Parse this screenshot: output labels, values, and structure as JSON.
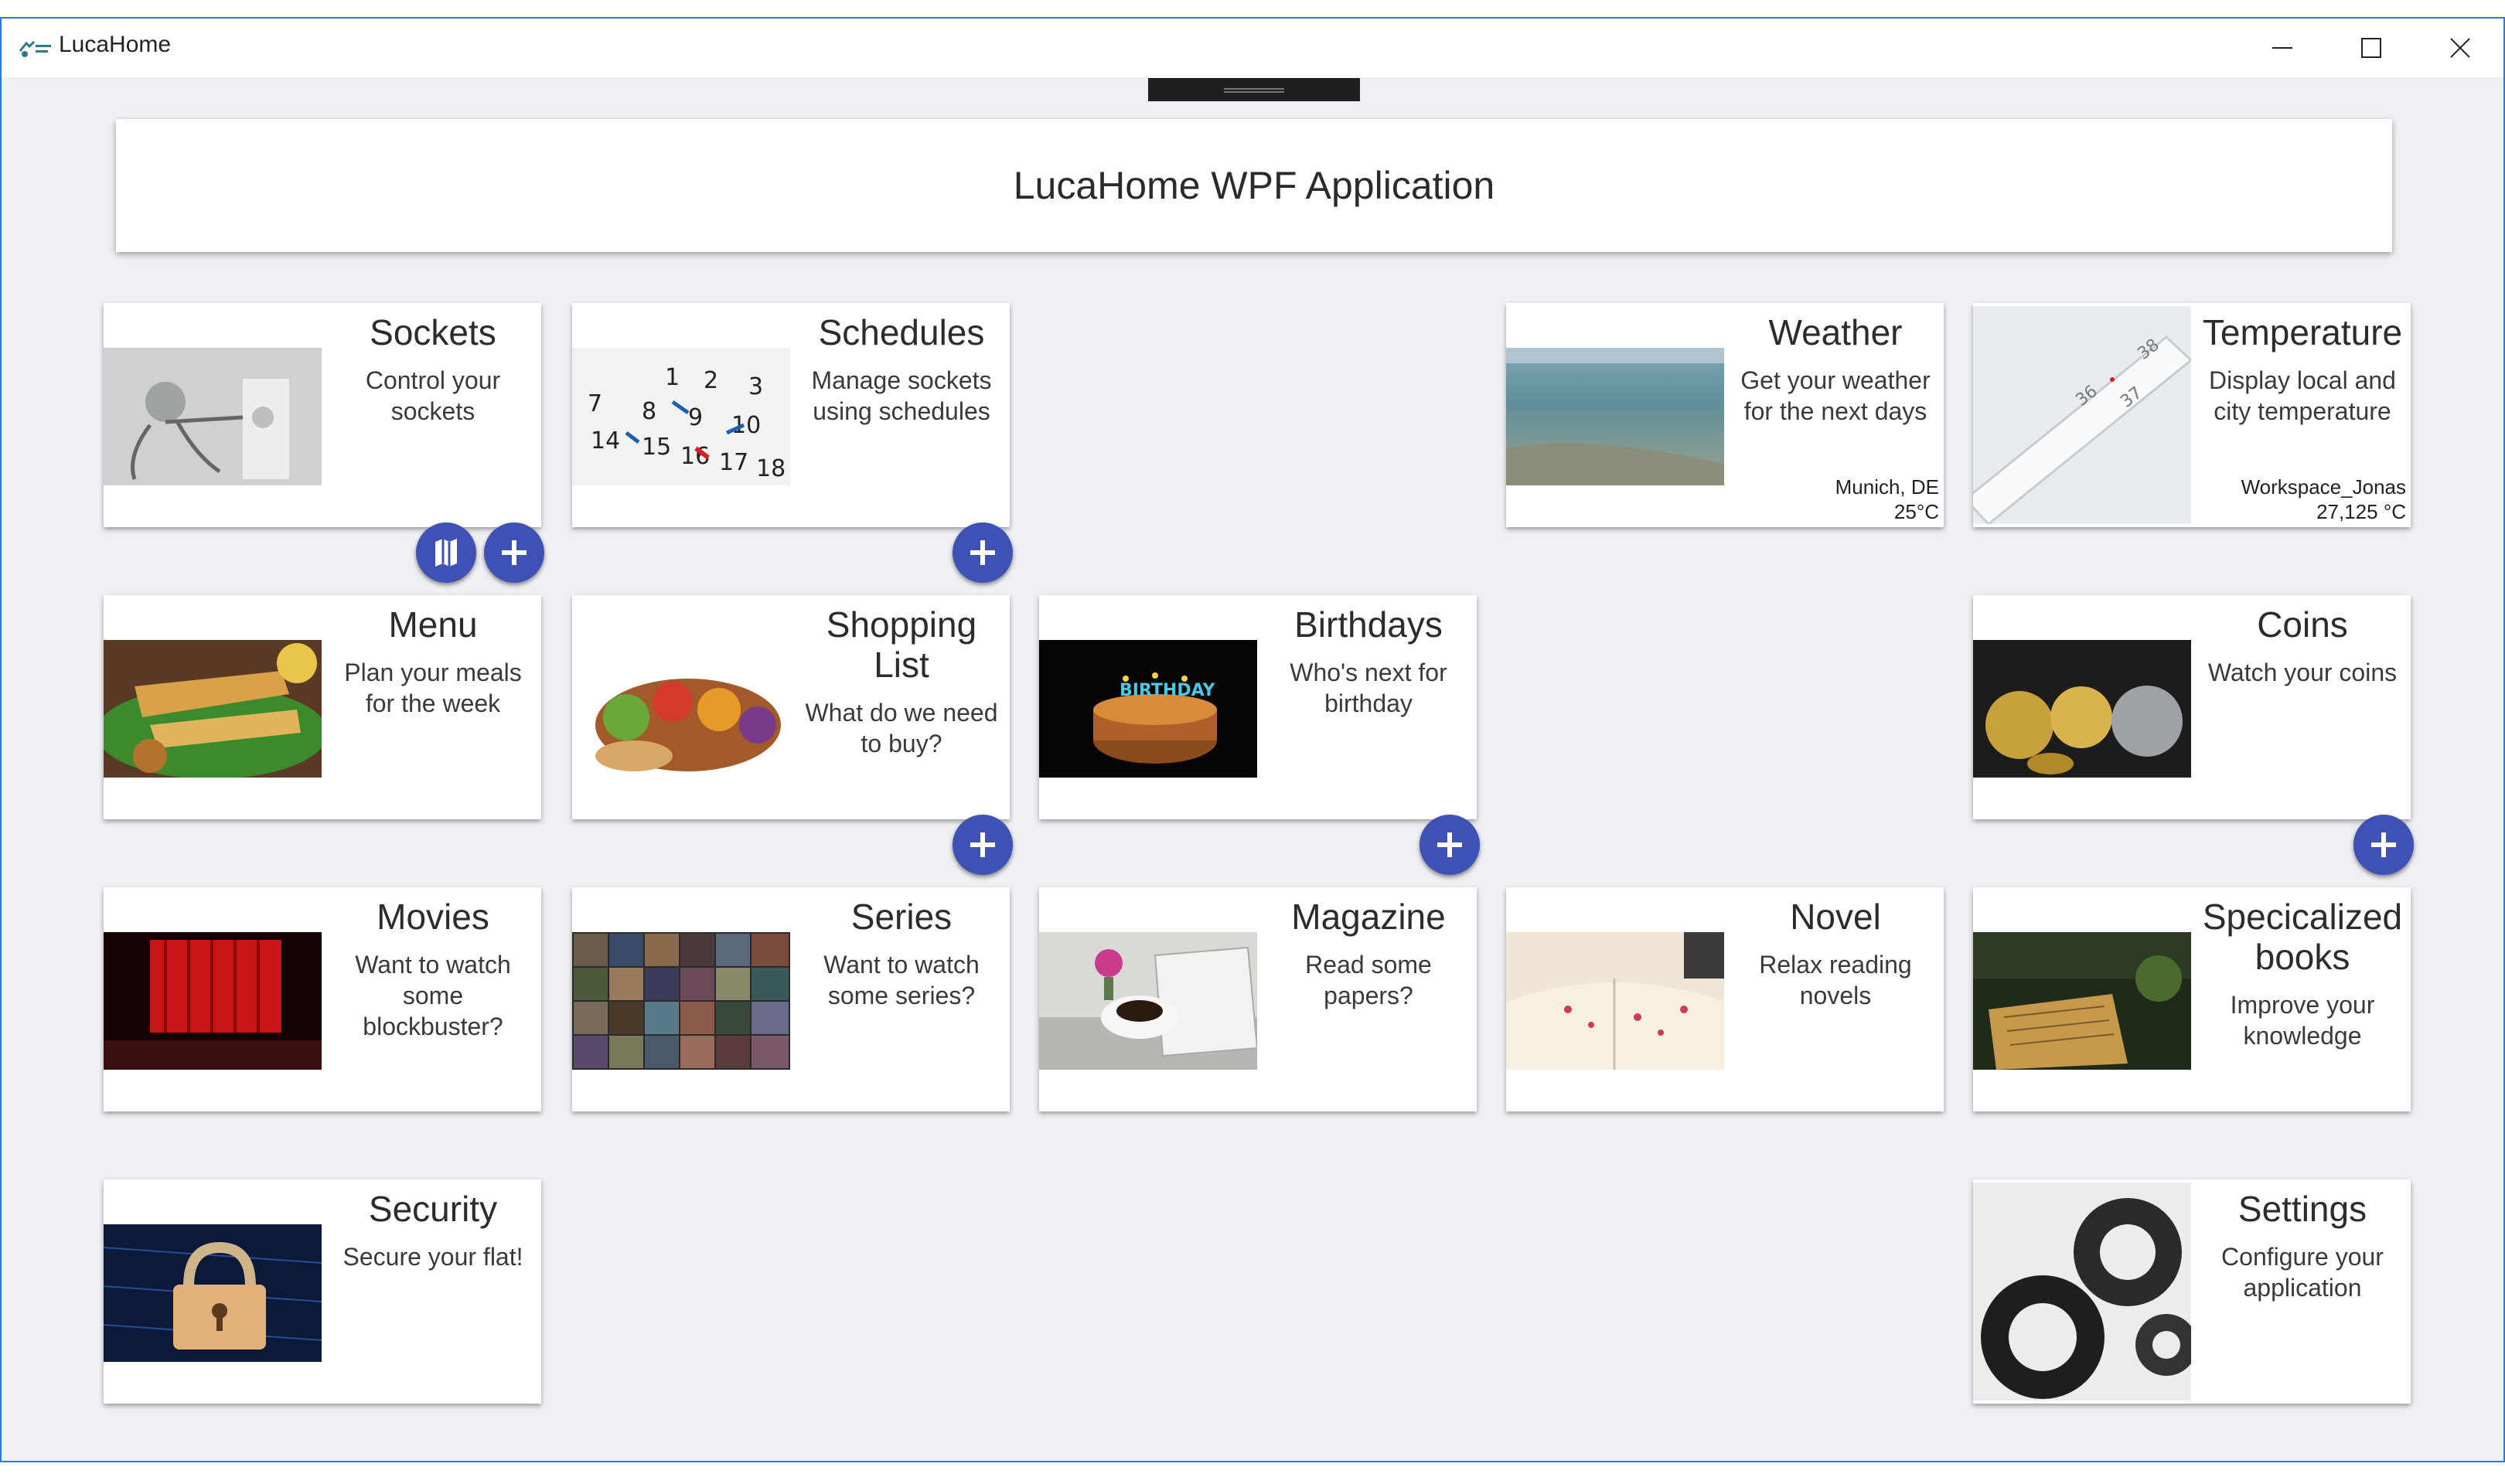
{
  "window": {
    "title": "LucaHome"
  },
  "header": {
    "title": "LucaHome WPF Application"
  },
  "cards": {
    "sockets": {
      "title": "Sockets",
      "desc": "Control your sockets"
    },
    "schedules": {
      "title": "Schedules",
      "desc": "Manage sockets using schedules"
    },
    "weather": {
      "title": "Weather",
      "desc": "Get your weather for the next days",
      "info1": "Munich, DE",
      "info2": "25°C"
    },
    "temperature": {
      "title": "Temperature",
      "desc": "Display local and city temperature",
      "info1": "Workspace_Jonas",
      "info2": "27,125 °C"
    },
    "menu": {
      "title": "Menu",
      "desc": "Plan your meals for the week"
    },
    "shopping": {
      "title": "Shopping List",
      "desc": "What do we need to buy?"
    },
    "birthdays": {
      "title": "Birthdays",
      "desc": "Who's next for birthday"
    },
    "coins": {
      "title": "Coins",
      "desc": "Watch your coins"
    },
    "movies": {
      "title": "Movies",
      "desc": "Want to watch some blockbuster?"
    },
    "series": {
      "title": "Series",
      "desc": "Want to watch some series?"
    },
    "magazine": {
      "title": "Magazine",
      "desc": "Read some papers?"
    },
    "novel": {
      "title": "Novel",
      "desc": "Relax reading novels"
    },
    "specialized": {
      "title": "Specicalized books",
      "desc": "Improve your knowledge"
    },
    "security": {
      "title": "Security",
      "desc": "Secure your flat!"
    },
    "settings": {
      "title": "Settings",
      "desc": "Configure your application"
    }
  },
  "icons": {
    "add": "plus-icon",
    "map": "map-icon",
    "minimize": "minimize-icon",
    "maximize": "maximize-icon",
    "close": "close-icon"
  },
  "colors": {
    "accent": "#3f51b5",
    "window_border": "#2b7bd6"
  }
}
